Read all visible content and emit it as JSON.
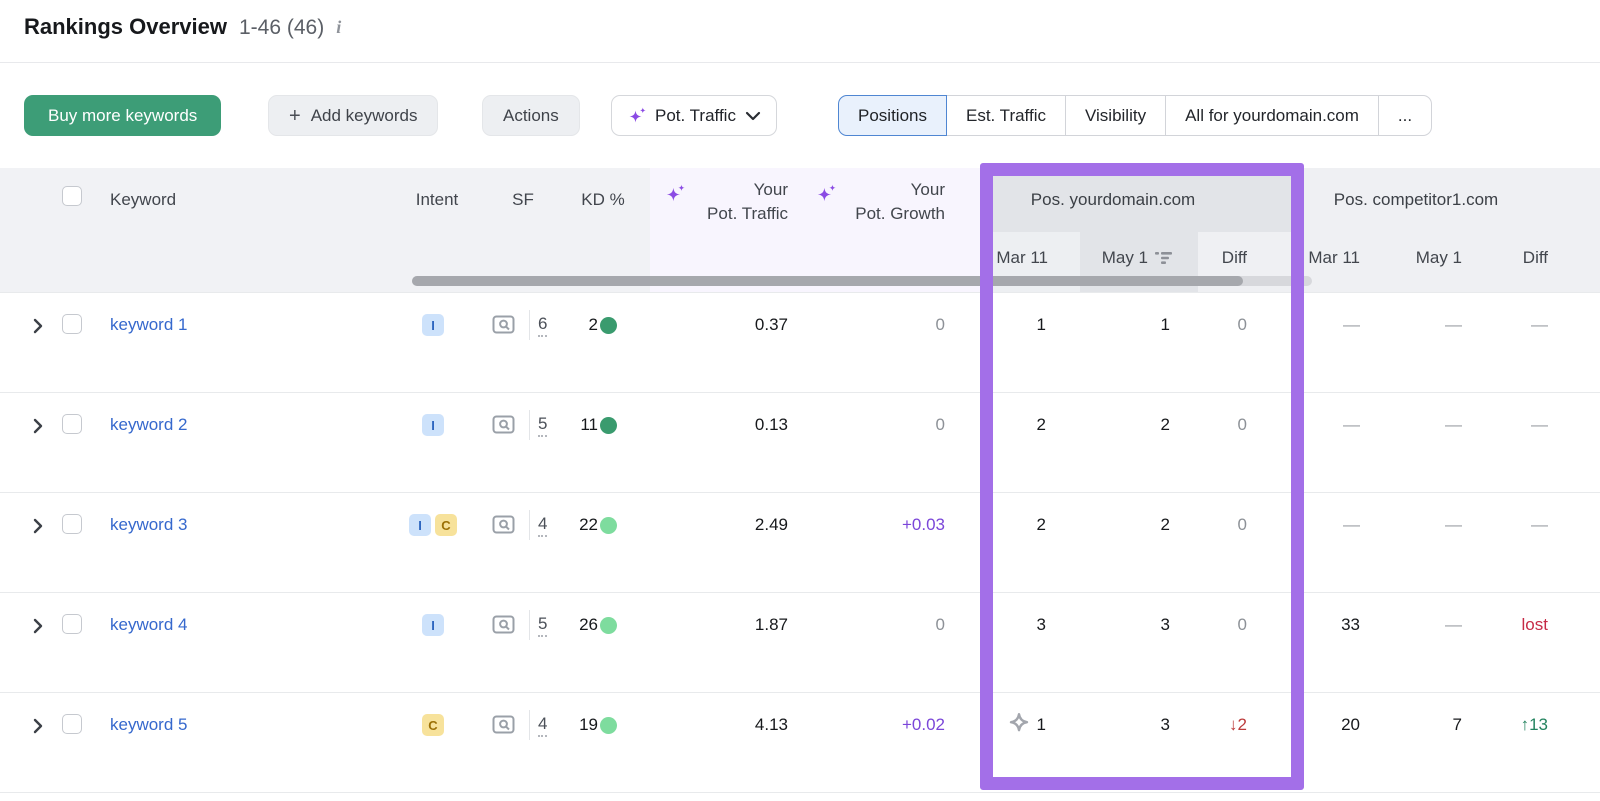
{
  "header": {
    "title": "Rankings Overview",
    "count": "1-46 (46)"
  },
  "toolbar": {
    "buy_more": "Buy more keywords",
    "add_keywords": "Add keywords",
    "actions": "Actions",
    "metric_selector": "Pot. Traffic",
    "tabs": [
      {
        "label": "Positions",
        "active": true
      },
      {
        "label": "Est. Traffic",
        "active": false
      },
      {
        "label": "Visibility",
        "active": false
      },
      {
        "label": "All for yourdomain.com",
        "active": false
      },
      {
        "label": "...",
        "active": false
      }
    ]
  },
  "table": {
    "headers": {
      "keyword": "Keyword",
      "intent": "Intent",
      "sf": "SF",
      "kd": "KD %",
      "pot_traffic_line1": "Your",
      "pot_traffic_line2": "Pot. Traffic",
      "pot_growth_line1": "Your",
      "pot_growth_line2": "Pot. Growth",
      "group_yourdomain": "Pos. yourdomain.com",
      "group_competitor": "Pos. competitor1.com",
      "sub_mar": "Mar 11",
      "sub_may": "May 1",
      "sub_diff": "Diff"
    },
    "rows": [
      {
        "keyword": "keyword 1",
        "intents": [
          "I"
        ],
        "sf": "6",
        "kd": "2",
        "kd_level": "dark",
        "pot_traffic": "0.37",
        "pot_growth": "0",
        "growth_variant": "muted",
        "pos_mar": "1",
        "serp_icon": "false",
        "pos_may": "1",
        "pos_diff": "0",
        "pos_diff_variant": "muted",
        "comp_mar": "—",
        "comp_mar_variant": "dash",
        "comp_may": "—",
        "comp_may_variant": "dash",
        "comp_diff": "—",
        "comp_diff_variant": "dash"
      },
      {
        "keyword": "keyword 2",
        "intents": [
          "I"
        ],
        "sf": "5",
        "kd": "11",
        "kd_level": "dark",
        "pot_traffic": "0.13",
        "pot_growth": "0",
        "growth_variant": "muted",
        "pos_mar": "2",
        "serp_icon": "false",
        "pos_may": "2",
        "pos_diff": "0",
        "pos_diff_variant": "muted",
        "comp_mar": "—",
        "comp_mar_variant": "dash",
        "comp_may": "—",
        "comp_may_variant": "dash",
        "comp_diff": "—",
        "comp_diff_variant": "dash"
      },
      {
        "keyword": "keyword 3",
        "intents": [
          "I",
          "C"
        ],
        "sf": "4",
        "kd": "22",
        "kd_level": "light",
        "pot_traffic": "2.49",
        "pot_growth": "+0.03",
        "growth_variant": "purple",
        "pos_mar": "2",
        "serp_icon": "false",
        "pos_may": "2",
        "pos_diff": "0",
        "pos_diff_variant": "muted",
        "comp_mar": "—",
        "comp_mar_variant": "dash",
        "comp_may": "—",
        "comp_may_variant": "dash",
        "comp_diff": "—",
        "comp_diff_variant": "dash"
      },
      {
        "keyword": "keyword 4",
        "intents": [
          "I"
        ],
        "sf": "5",
        "kd": "26",
        "kd_level": "light",
        "pot_traffic": "1.87",
        "pot_growth": "0",
        "growth_variant": "muted",
        "pos_mar": "3",
        "serp_icon": "false",
        "pos_may": "3",
        "pos_diff": "0",
        "pos_diff_variant": "muted",
        "comp_mar": "33",
        "comp_mar_variant": "dark",
        "comp_may": "—",
        "comp_may_variant": "dash",
        "comp_diff": "lost",
        "comp_diff_variant": "lost"
      },
      {
        "keyword": "keyword 5",
        "intents": [
          "C"
        ],
        "sf": "4",
        "kd": "19",
        "kd_level": "light",
        "pot_traffic": "4.13",
        "pot_growth": "+0.02",
        "growth_variant": "purple",
        "pos_mar": "1",
        "serp_icon": "true",
        "pos_may": "3",
        "pos_diff": "↓2",
        "pos_diff_variant": "negative",
        "comp_mar": "20",
        "comp_mar_variant": "dark",
        "comp_may": "7",
        "comp_may_variant": "dark",
        "comp_diff": "↑13",
        "comp_diff_variant": "positive"
      }
    ]
  },
  "colors": {
    "highlight_purple": "#a36fe8",
    "buy_button_green": "#3d9d77",
    "ai_sparkle_purple": "#8b4be4",
    "link_blue": "#3568cd",
    "kd_dot_dark_green": "#3a9b6e",
    "kd_dot_light_green": "#7edc9e",
    "growth_purple": "#7b46d9",
    "diff_negative_red": "#bc3b3b",
    "lost_red": "#c62b46",
    "diff_positive_green": "#23835f",
    "selected_tab_blue": "#4f86d2"
  },
  "icons": {
    "info": "i",
    "plus": "+",
    "chevron_down": "v",
    "chevron_right": ">",
    "ai_sparkle": "four-point star",
    "sort_desc": "descending bars",
    "serp_features_preview": "window with magnifier",
    "serp_feature_marker": "hollow four-point star"
  }
}
